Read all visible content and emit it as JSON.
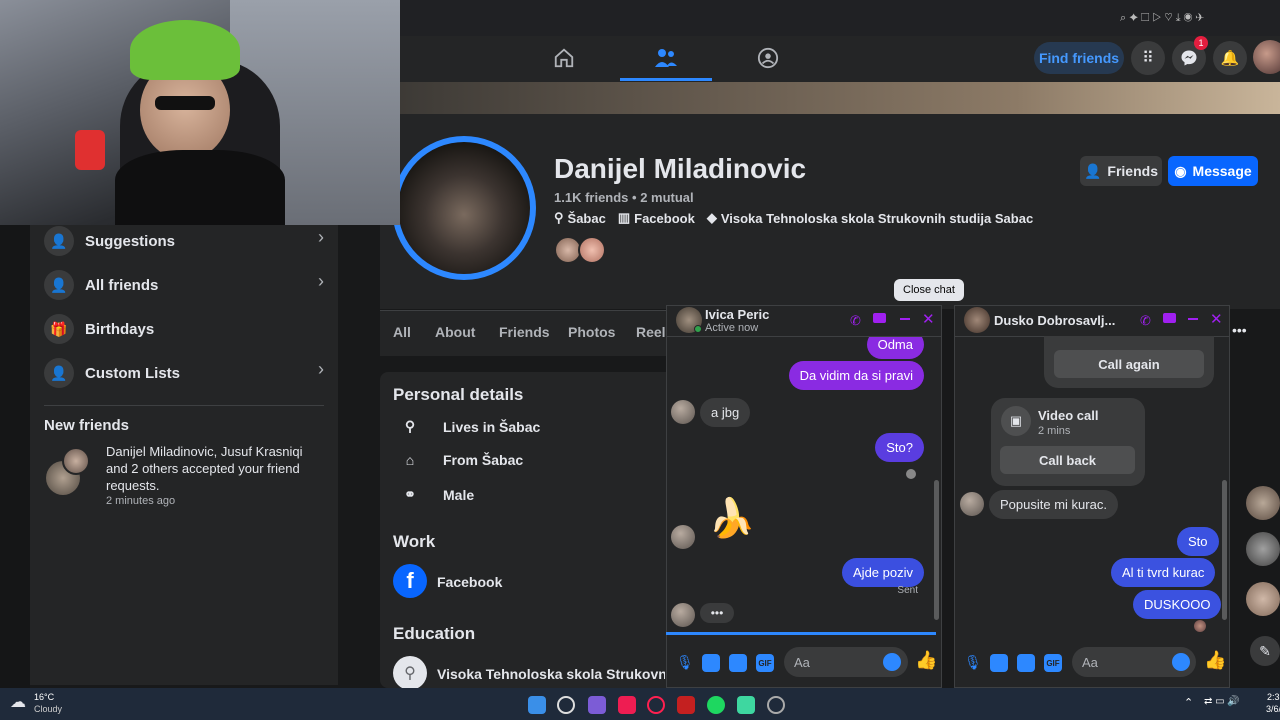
{
  "nav": {
    "find_friends": "Find friends",
    "messenger_badge": "1"
  },
  "sidebar": {
    "items": [
      {
        "label": "Suggestions"
      },
      {
        "label": "All friends"
      },
      {
        "label": "Birthdays"
      },
      {
        "label": "Custom Lists"
      }
    ],
    "new_friends_title": "New friends",
    "new_friends_text": "Danijel Miladinovic, Jusuf Krasniqi and 2 others accepted your friend requests.",
    "new_friends_time": "2 minutes ago"
  },
  "profile": {
    "name": "Danijel Miladinovic",
    "stats": "1.1K friends • 2 mutual",
    "location": "Šabac",
    "work_short": "Facebook",
    "school": "Visoka Tehnoloska skola Strukovnih studija Sabac",
    "friends_button": "Friends",
    "message_button": "Message"
  },
  "tabs": [
    "All",
    "About",
    "Friends",
    "Photos",
    "Reels"
  ],
  "intro": {
    "personal_title": "Personal details",
    "lives": "Lives in Šabac",
    "from": "From Šabac",
    "gender": "Male",
    "work_title": "Work",
    "work": "Facebook",
    "edu_title": "Education",
    "edu": "Visoka Tehnoloska skola Strukovnih stu"
  },
  "chat1": {
    "name": "Ivica Peric",
    "status": "Active now",
    "tooltip": "Close chat",
    "messages": {
      "m0": "Odma",
      "m1": "Da vidim da si pravi",
      "m2": "a jbg",
      "m3": "Sto?",
      "m4": "Ajde poziv",
      "sent": "Sent"
    },
    "placeholder": "Aa"
  },
  "chat2": {
    "name": "Dusko Dobrosavlj...",
    "call_again": "Call again",
    "video_call": "Video call",
    "video_time": "2 mins",
    "call_back": "Call back",
    "m1": "Popusite mi kurac.",
    "m2": "Sto",
    "m3": "Al ti tvrd kurac",
    "m4": "DUSKOOO",
    "placeholder": "Aa"
  },
  "taskbar": {
    "temp": "16°C",
    "weather": "Cloudy",
    "time": "2:3",
    "date": "3/6/"
  },
  "colors": {
    "fb_blue": "#0866ff",
    "purple": "#8a2be2",
    "bg": "#18191a"
  }
}
